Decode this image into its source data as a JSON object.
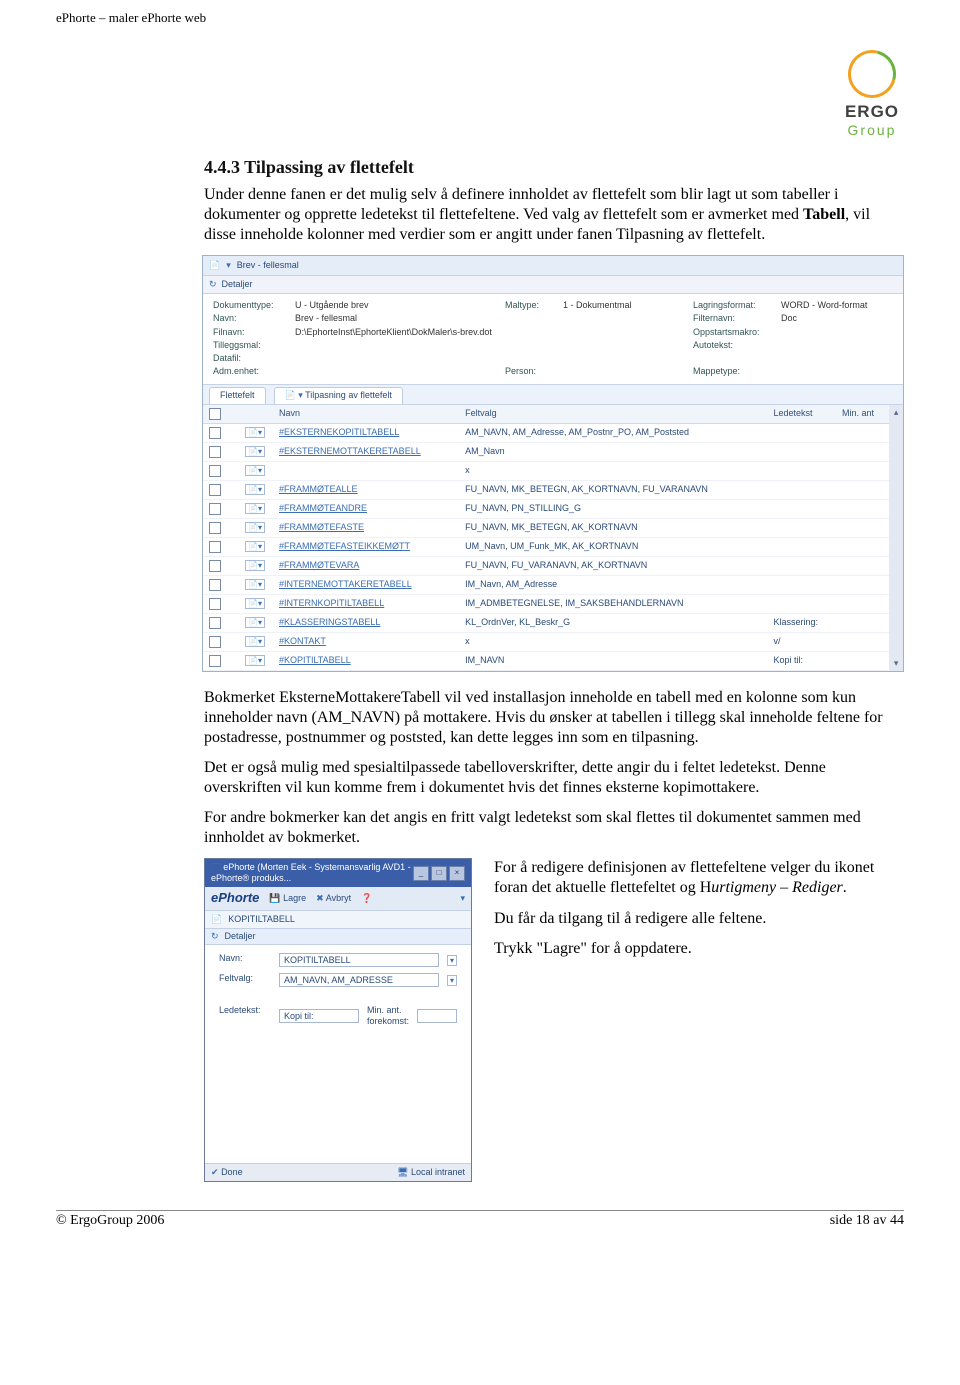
{
  "header": {
    "title": "ePhorte – maler ePhorte web"
  },
  "logo": {
    "name": "ERGO",
    "sub": "Group"
  },
  "section": {
    "heading": "4.4.3 Tilpassing av flettefelt",
    "para1": "Under denne fanen er det mulig selv å definere innholdet av flettefelt som blir lagt ut som tabeller i dokumenter og opprette ledetekst til flettefeltene. Ved valg av flettefelt som er avmerket med ",
    "para1_bold": "Tabell",
    "para1_cont": ", vil disse inneholde kolonner med verdier som er angitt under fanen Tilpasning av flettefelt.",
    "para2": "Bokmerket EksterneMottakereTabell vil ved installasjon inneholde en tabell med en kolonne som kun inneholder navn (AM_NAVN) på mottakere. Hvis du ønsker at tabellen i tillegg skal inneholde feltene for postadresse, postnummer og poststed, kan dette legges inn som en tilpasning.",
    "para3": "Det er også mulig med spesialtilpassede tabelloverskrifter, dette angir du i feltet ledetekst. Denne overskriften vil kun komme frem i dokumentet hvis det finnes eksterne kopimottakere.",
    "para4": "For andre bokmerker kan det angis en fritt valgt ledetekst som skal flettes til dokumentet sammen med innholdet av bokmerket."
  },
  "screenshot1": {
    "title": "Brev - fellesmal",
    "detaljer": "Detaljer",
    "form": {
      "Dokumenttype": "U - Utgående brev",
      "Maltype": "1 - Dokumentmal",
      "Lagringsformat": "WORD - Word-format",
      "Navn": "Brev - fellesmal",
      "Filternavn": "Doc",
      "Filnavn": "D:\\EphorteInst\\EphorteKlient\\DokMaler\\s-brev.dot",
      "Oppstartsmakro": "",
      "Tilleggsmal": "",
      "Autotekst": "",
      "Datafil": "",
      "Adm_enhet": "",
      "Person": "",
      "Mappetype": ""
    },
    "tabs": [
      "Flettefelt",
      "Tilpasning av flettefelt"
    ],
    "columns": [
      "",
      "",
      "Navn",
      "Feltvalg",
      "Ledetekst",
      "Min. ant"
    ],
    "rows": [
      {
        "name": "#EKSTERNEKOPITILTABELL",
        "feltvalg": "AM_NAVN, AM_Adresse, AM_Postnr_PO, AM_Poststed",
        "lede": "",
        "min": ""
      },
      {
        "name": "#EKSTERNEMOTTAKERETABELL",
        "feltvalg": "AM_Navn",
        "lede": "",
        "min": ""
      },
      {
        "name": "",
        "feltvalg": "x",
        "lede": "",
        "min": ""
      },
      {
        "name": "#FRAMMØTEALLE",
        "feltvalg": "FU_NAVN, MK_BETEGN, AK_KORTNAVN, FU_VARANAVN",
        "lede": "",
        "min": ""
      },
      {
        "name": "#FRAMMØTEANDRE",
        "feltvalg": "FU_NAVN, PN_STILLING_G",
        "lede": "",
        "min": ""
      },
      {
        "name": "#FRAMMØTEFASTE",
        "feltvalg": "FU_NAVN, MK_BETEGN, AK_KORTNAVN",
        "lede": "",
        "min": ""
      },
      {
        "name": "#FRAMMØTEFASTEIKKEMØTT",
        "feltvalg": "UM_Navn, UM_Funk_MK, AK_KORTNAVN",
        "lede": "",
        "min": ""
      },
      {
        "name": "#FRAMMØTEVARA",
        "feltvalg": "FU_NAVN, FU_VARANAVN, AK_KORTNAVN",
        "lede": "",
        "min": ""
      },
      {
        "name": "#INTERNEMOTTAKERETABELL",
        "feltvalg": "IM_Navn, AM_Adresse",
        "lede": "",
        "min": ""
      },
      {
        "name": "#INTERNKOPITILTABELL",
        "feltvalg": "IM_ADMBETEGNELSE, IM_SAKSBEHANDLERNAVN",
        "lede": "",
        "min": ""
      },
      {
        "name": "#KLASSERINGSTABELL",
        "feltvalg": "KL_OrdnVer, KL_Beskr_G",
        "lede": "Klassering:",
        "min": ""
      },
      {
        "name": "#KONTAKT",
        "feltvalg": "x",
        "lede": "v/",
        "min": ""
      },
      {
        "name": "#KOPITILTABELL",
        "feltvalg": "IM_NAVN",
        "lede": "Kopi til:",
        "min": ""
      }
    ]
  },
  "screenshot2": {
    "title": "ePhorte (Morten Eek - Systemansvarlig AVD1 - ePhorte® produks...",
    "brand": "ePhorte",
    "lagre": "Lagre",
    "avbryt": "Avbryt",
    "tab": "KOPITILTABELL",
    "detaljer": "Detaljer",
    "navn_label": "Navn:",
    "navn_value": "KOPITILTABELL",
    "feltvalg_label": "Feltvalg:",
    "feltvalg_value": "AM_NAVN, AM_ADRESSE",
    "ledetekst_label": "Ledetekst:",
    "ledetekst_value": "Kopi til:",
    "minant_label": "Min. ant. forekomst:",
    "status_done": "Done",
    "status_right": "Local intranet"
  },
  "right_text": {
    "p1a": "For å redigere definisjonen av flettefeltene velger du ikonet foran det aktuelle flettefeltet og H",
    "p1b_italic": "urtigmeny – Rediger",
    "p1c": ".",
    "p2": "Du får da tilgang til å redigere alle feltene.",
    "p3": "Trykk \"Lagre\" for å oppdatere."
  },
  "footer": {
    "left": "© ErgoGroup 2006",
    "right": "side 18 av 44"
  },
  "labels": {
    "lbl_doktype": "Dokumenttype:",
    "lbl_navn": "Navn:",
    "lbl_filnavn": "Filnavn:",
    "lbl_tilleggs": "Tilleggsmal:",
    "lbl_datafil": "Datafil:",
    "lbl_admenhet": "Adm.enhet:",
    "lbl_maltype": "Maltype:",
    "lbl_person": "Person:",
    "lbl_lagring": "Lagringsformat:",
    "lbl_filternavn": "Filternavn:",
    "lbl_oppstart": "Oppstartsmakro:",
    "lbl_autotekst": "Autotekst:",
    "lbl_mappetype": "Mappetype:"
  }
}
